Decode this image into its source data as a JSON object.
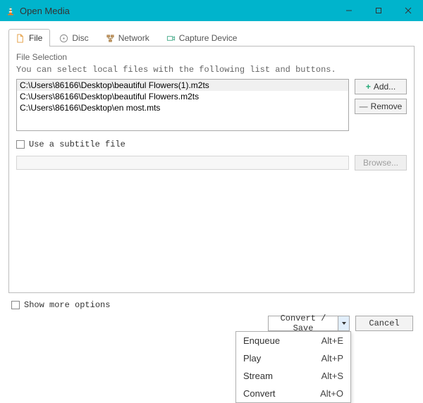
{
  "window": {
    "title": "Open Media"
  },
  "tabs": {
    "file": "File",
    "disc": "Disc",
    "network": "Network",
    "capture": "Capture Device"
  },
  "file_panel": {
    "section_title": "File Selection",
    "hint": "You can select local files with the following list and buttons.",
    "files": [
      "C:\\Users\\86166\\Desktop\\beautiful Flowers(1).m2ts",
      "C:\\Users\\86166\\Desktop\\beautiful Flowers.m2ts",
      "C:\\Users\\86166\\Desktop\\en most.mts"
    ],
    "add_label": "Add...",
    "remove_label": "Remove",
    "subtitle_checkbox": "Use a subtitle file",
    "browse_label": "Browse..."
  },
  "show_more": "Show more options",
  "bottom": {
    "convert_save": "Convert / Save",
    "cancel": "Cancel"
  },
  "menu": {
    "items": [
      {
        "label": "Enqueue",
        "shortcut": "Alt+E"
      },
      {
        "label": "Play",
        "shortcut": "Alt+P"
      },
      {
        "label": "Stream",
        "shortcut": "Alt+S"
      },
      {
        "label": "Convert",
        "shortcut": "Alt+O"
      }
    ]
  }
}
